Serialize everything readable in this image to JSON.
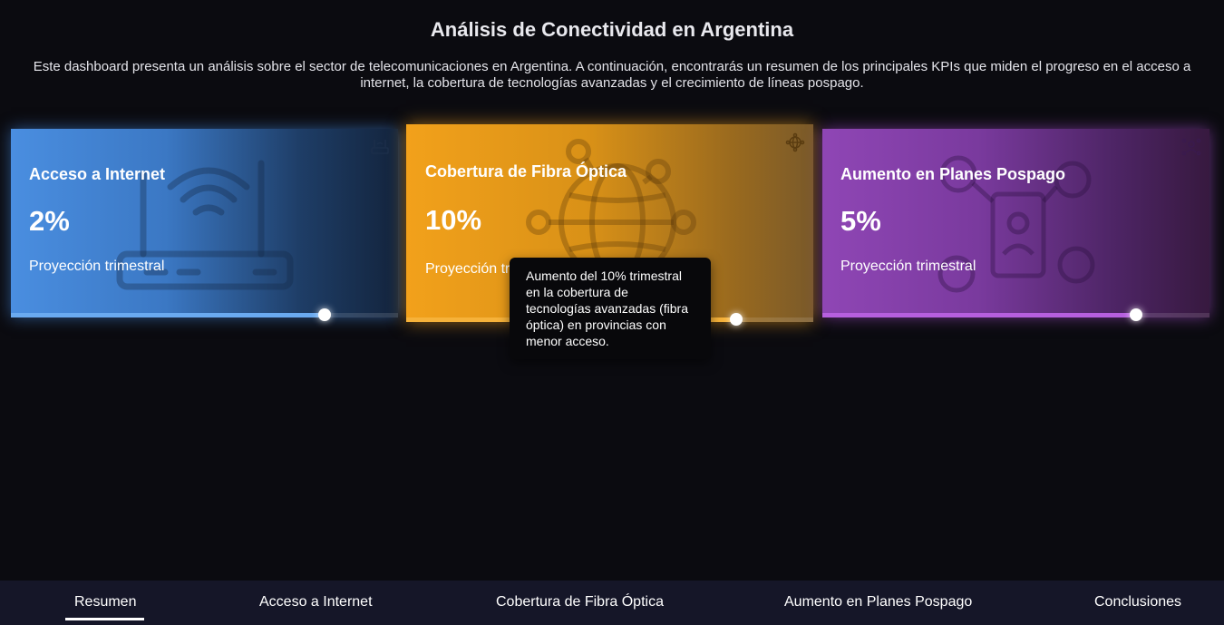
{
  "header": {
    "title": "Análisis de Conectividad en Argentina",
    "intro": "Este dashboard presenta un análisis sobre el sector de telecomunicaciones en Argentina. A continuación, encontrarás un resumen de los principales KPIs que miden el progreso en el acceso a internet, la cobertura de tecnologías avanzadas y el crecimiento de líneas pospago."
  },
  "cards": [
    {
      "title": "Acceso a Internet",
      "value": "2%",
      "subtitle": "Proyección trimestral",
      "icon": "router-icon",
      "progress": 0.81,
      "progress_color": "#6aaaf0"
    },
    {
      "title": "Cobertura de Fibra Óptica",
      "value": "10%",
      "subtitle": "Proyección trimestral",
      "icon": "globe-network-icon",
      "progress": 0.81,
      "progress_color": "#f6b23a"
    },
    {
      "title": "Aumento en Planes Pospago",
      "value": "5%",
      "subtitle": "Proyección trimestral",
      "icon": "people-network-icon",
      "progress": 0.81,
      "progress_color": "#b65fde"
    }
  ],
  "tooltip": {
    "text": "Aumento del 10% trimestral en la cobertura de tecnologías avanzadas (fibra óptica) en provincias con menor acceso."
  },
  "nav": {
    "items": [
      "Resumen",
      "Acceso a Internet",
      "Cobertura de Fibra Óptica",
      "Aumento en Planes Pospago",
      "Conclusiones"
    ],
    "active": "Resumen"
  }
}
